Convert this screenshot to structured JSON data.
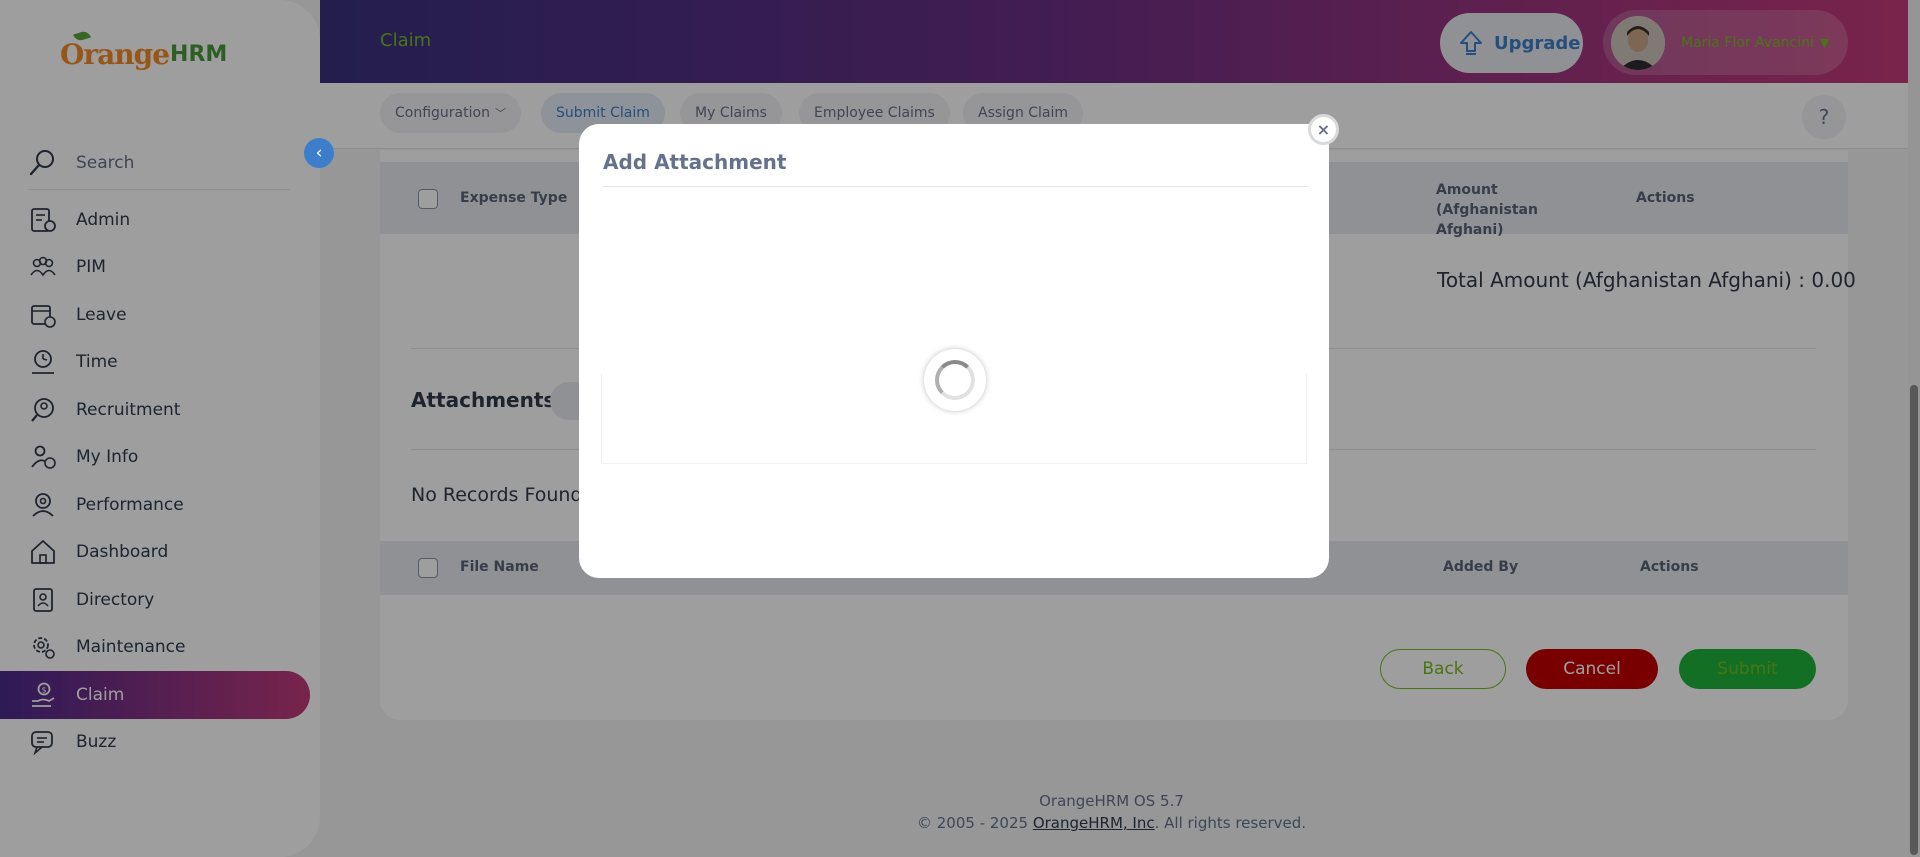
{
  "brand": {
    "orange": "Orange",
    "hrm": "HRM"
  },
  "sidebar": {
    "search_label": "Search",
    "items": [
      {
        "label": "Admin",
        "icon": "admin-icon"
      },
      {
        "label": "PIM",
        "icon": "pim-icon"
      },
      {
        "label": "Leave",
        "icon": "leave-icon"
      },
      {
        "label": "Time",
        "icon": "time-icon"
      },
      {
        "label": "Recruitment",
        "icon": "recruitment-icon"
      },
      {
        "label": "My Info",
        "icon": "my-info-icon"
      },
      {
        "label": "Performance",
        "icon": "performance-icon"
      },
      {
        "label": "Dashboard",
        "icon": "dashboard-icon"
      },
      {
        "label": "Directory",
        "icon": "directory-icon"
      },
      {
        "label": "Maintenance",
        "icon": "maintenance-icon"
      },
      {
        "label": "Claim",
        "icon": "claim-icon",
        "active": true
      },
      {
        "label": "Buzz",
        "icon": "buzz-icon"
      }
    ]
  },
  "header": {
    "title": "Claim",
    "upgrade_label": "Upgrade",
    "user_name": "Maria Flor Avancini"
  },
  "subnav": {
    "tabs": [
      {
        "label": "Configuration",
        "has_dropdown": true
      },
      {
        "label": "Submit Claim",
        "active": true
      },
      {
        "label": "My Claims"
      },
      {
        "label": "Employee Claims"
      },
      {
        "label": "Assign Claim"
      }
    ],
    "help_label": "?"
  },
  "expenses_table": {
    "columns": [
      "Expense Type",
      "Amount (Afghanistan Afghani)",
      "Actions"
    ],
    "total_text": "Total Amount (Afghanistan Afghani) : 0.00"
  },
  "attachments": {
    "title": "Attachments",
    "empty_text": "No Records Found",
    "columns": [
      "File Name",
      "Added By",
      "Actions"
    ]
  },
  "actions": {
    "back": "Back",
    "cancel": "Cancel",
    "submit": "Submit"
  },
  "footer": {
    "version": "OrangeHRM OS 5.7",
    "copyright_prefix": "© 2005 - 2025 ",
    "company_link": "OrangeHRM, Inc",
    "copyright_suffix": ". All rights reserved."
  },
  "modal": {
    "title": "Add Attachment",
    "close_label": "×",
    "state": "loading"
  },
  "colors": {
    "accent_green": "#76bc21",
    "accent_blue": "#3d7ecb",
    "cancel_red": "#c40000",
    "submit_green": "#20b33a",
    "header_gradient_start": "#39317f",
    "header_gradient_end": "#c43a7a"
  }
}
